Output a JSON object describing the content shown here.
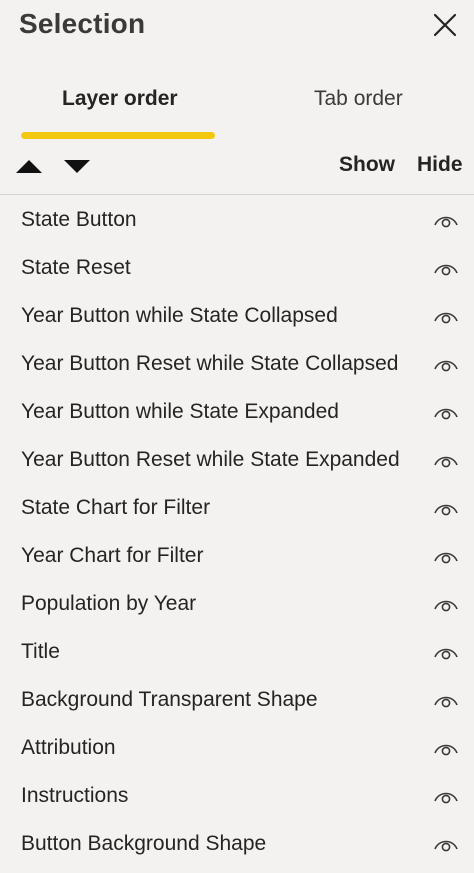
{
  "pane": {
    "title": "Selection"
  },
  "tabs": [
    {
      "label": "Layer order",
      "selected": true
    },
    {
      "label": "Tab order",
      "selected": false
    }
  ],
  "toolbar": {
    "move_up_icon": "triangle-up-icon",
    "move_down_icon": "triangle-down-icon",
    "show_label": "Show",
    "hide_label": "Hide"
  },
  "layers": [
    {
      "label": "State Button",
      "visible": true
    },
    {
      "label": "State Reset",
      "visible": true
    },
    {
      "label": "Year Button while State Collapsed",
      "visible": true
    },
    {
      "label": "Year Button Reset while State Collapsed",
      "visible": true
    },
    {
      "label": "Year Button while State Expanded",
      "visible": true
    },
    {
      "label": "Year Button Reset while State Expanded",
      "visible": true
    },
    {
      "label": "State Chart for Filter",
      "visible": true
    },
    {
      "label": "Year Chart for Filter",
      "visible": true
    },
    {
      "label": "Population by Year",
      "visible": true
    },
    {
      "label": "Title",
      "visible": true
    },
    {
      "label": "Background Transparent Shape",
      "visible": true
    },
    {
      "label": "Attribution",
      "visible": true
    },
    {
      "label": "Instructions",
      "visible": true
    },
    {
      "label": "Button Background Shape",
      "visible": true
    }
  ],
  "colors": {
    "background": "#f3f2f1",
    "accent": "#f2c811",
    "text": "#252423"
  }
}
